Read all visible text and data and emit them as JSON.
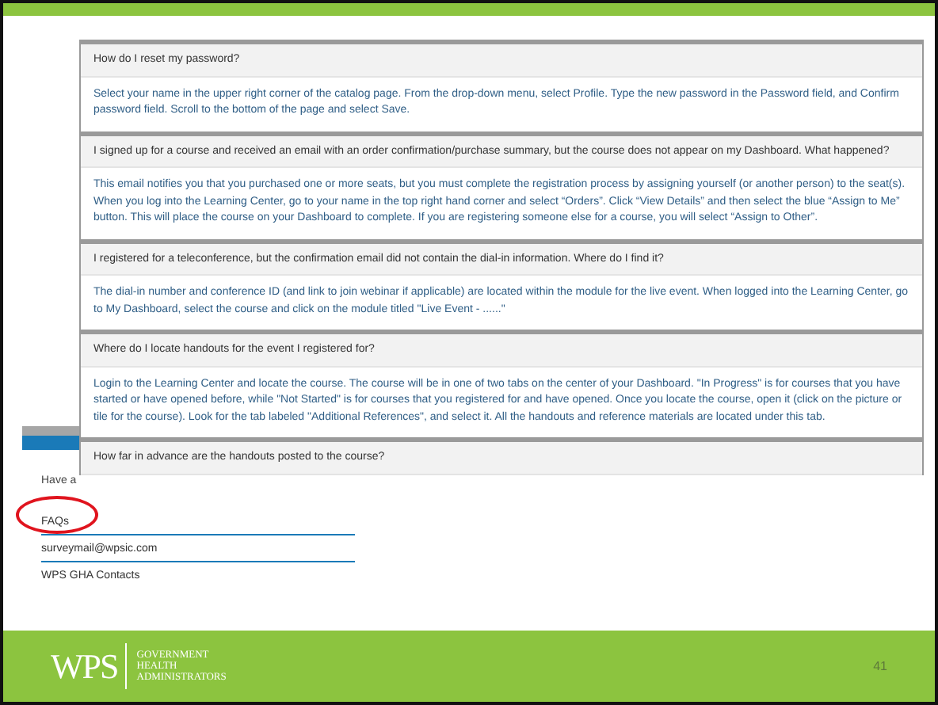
{
  "background_page": {
    "partial_text": "Have a",
    "links": [
      "FAQs",
      "surveymail@wpsic.com",
      "WPS GHA Contacts"
    ]
  },
  "faq_panel": {
    "items": [
      {
        "question": "How do I reset my password?",
        "answer": "Select your name in the upper right corner of the catalog page. From the drop-down menu, select Profile. Type the new password in the Password field, and Confirm password field. Scroll to the bottom of the page and select Save."
      },
      {
        "question": "I signed up for a course and received an email with an order confirmation/purchase summary, but the course does not appear on my Dashboard. What happened?",
        "answer": "This email notifies you that you purchased one or more seats, but you must complete the registration process by assigning yourself (or another person) to the seat(s). When you log into the Learning Center, go to your name in the top right hand corner and select “Orders”. Click “View Details” and then select the blue “Assign to Me” button. This will place the course on your Dashboard to complete. If you are registering someone else for a course, you will select “Assign to Other”."
      },
      {
        "question": "I registered for a teleconference, but the confirmation email did not contain the dial-in information. Where do I find it?",
        "answer": "The dial-in number and conference ID (and link to join webinar if applicable) are located within the module for the live event. When logged into the Learning Center, go to My Dashboard, select the course and click on the module titled \"Live Event - ......\""
      },
      {
        "question": "Where do I locate handouts for the event I registered for?",
        "answer": "Login to the Learning Center and locate the course. The course will be in one of two tabs on the center of your Dashboard. \"In Progress\" is for courses that you have started or have opened before, while \"Not Started\" is for courses that you registered for and have opened. Once you locate the course, open it (click on the picture or tile for the course). Look for the tab labeled \"Additional References\", and select it. All the handouts and reference materials are located under this tab."
      },
      {
        "question": "How far in advance are the handouts posted to the course?"
      }
    ]
  },
  "footer": {
    "logo": "WPS",
    "tagline": [
      "GOVERNMENT",
      "HEALTH",
      "ADMINISTRATORS"
    ],
    "page_number": "41"
  }
}
